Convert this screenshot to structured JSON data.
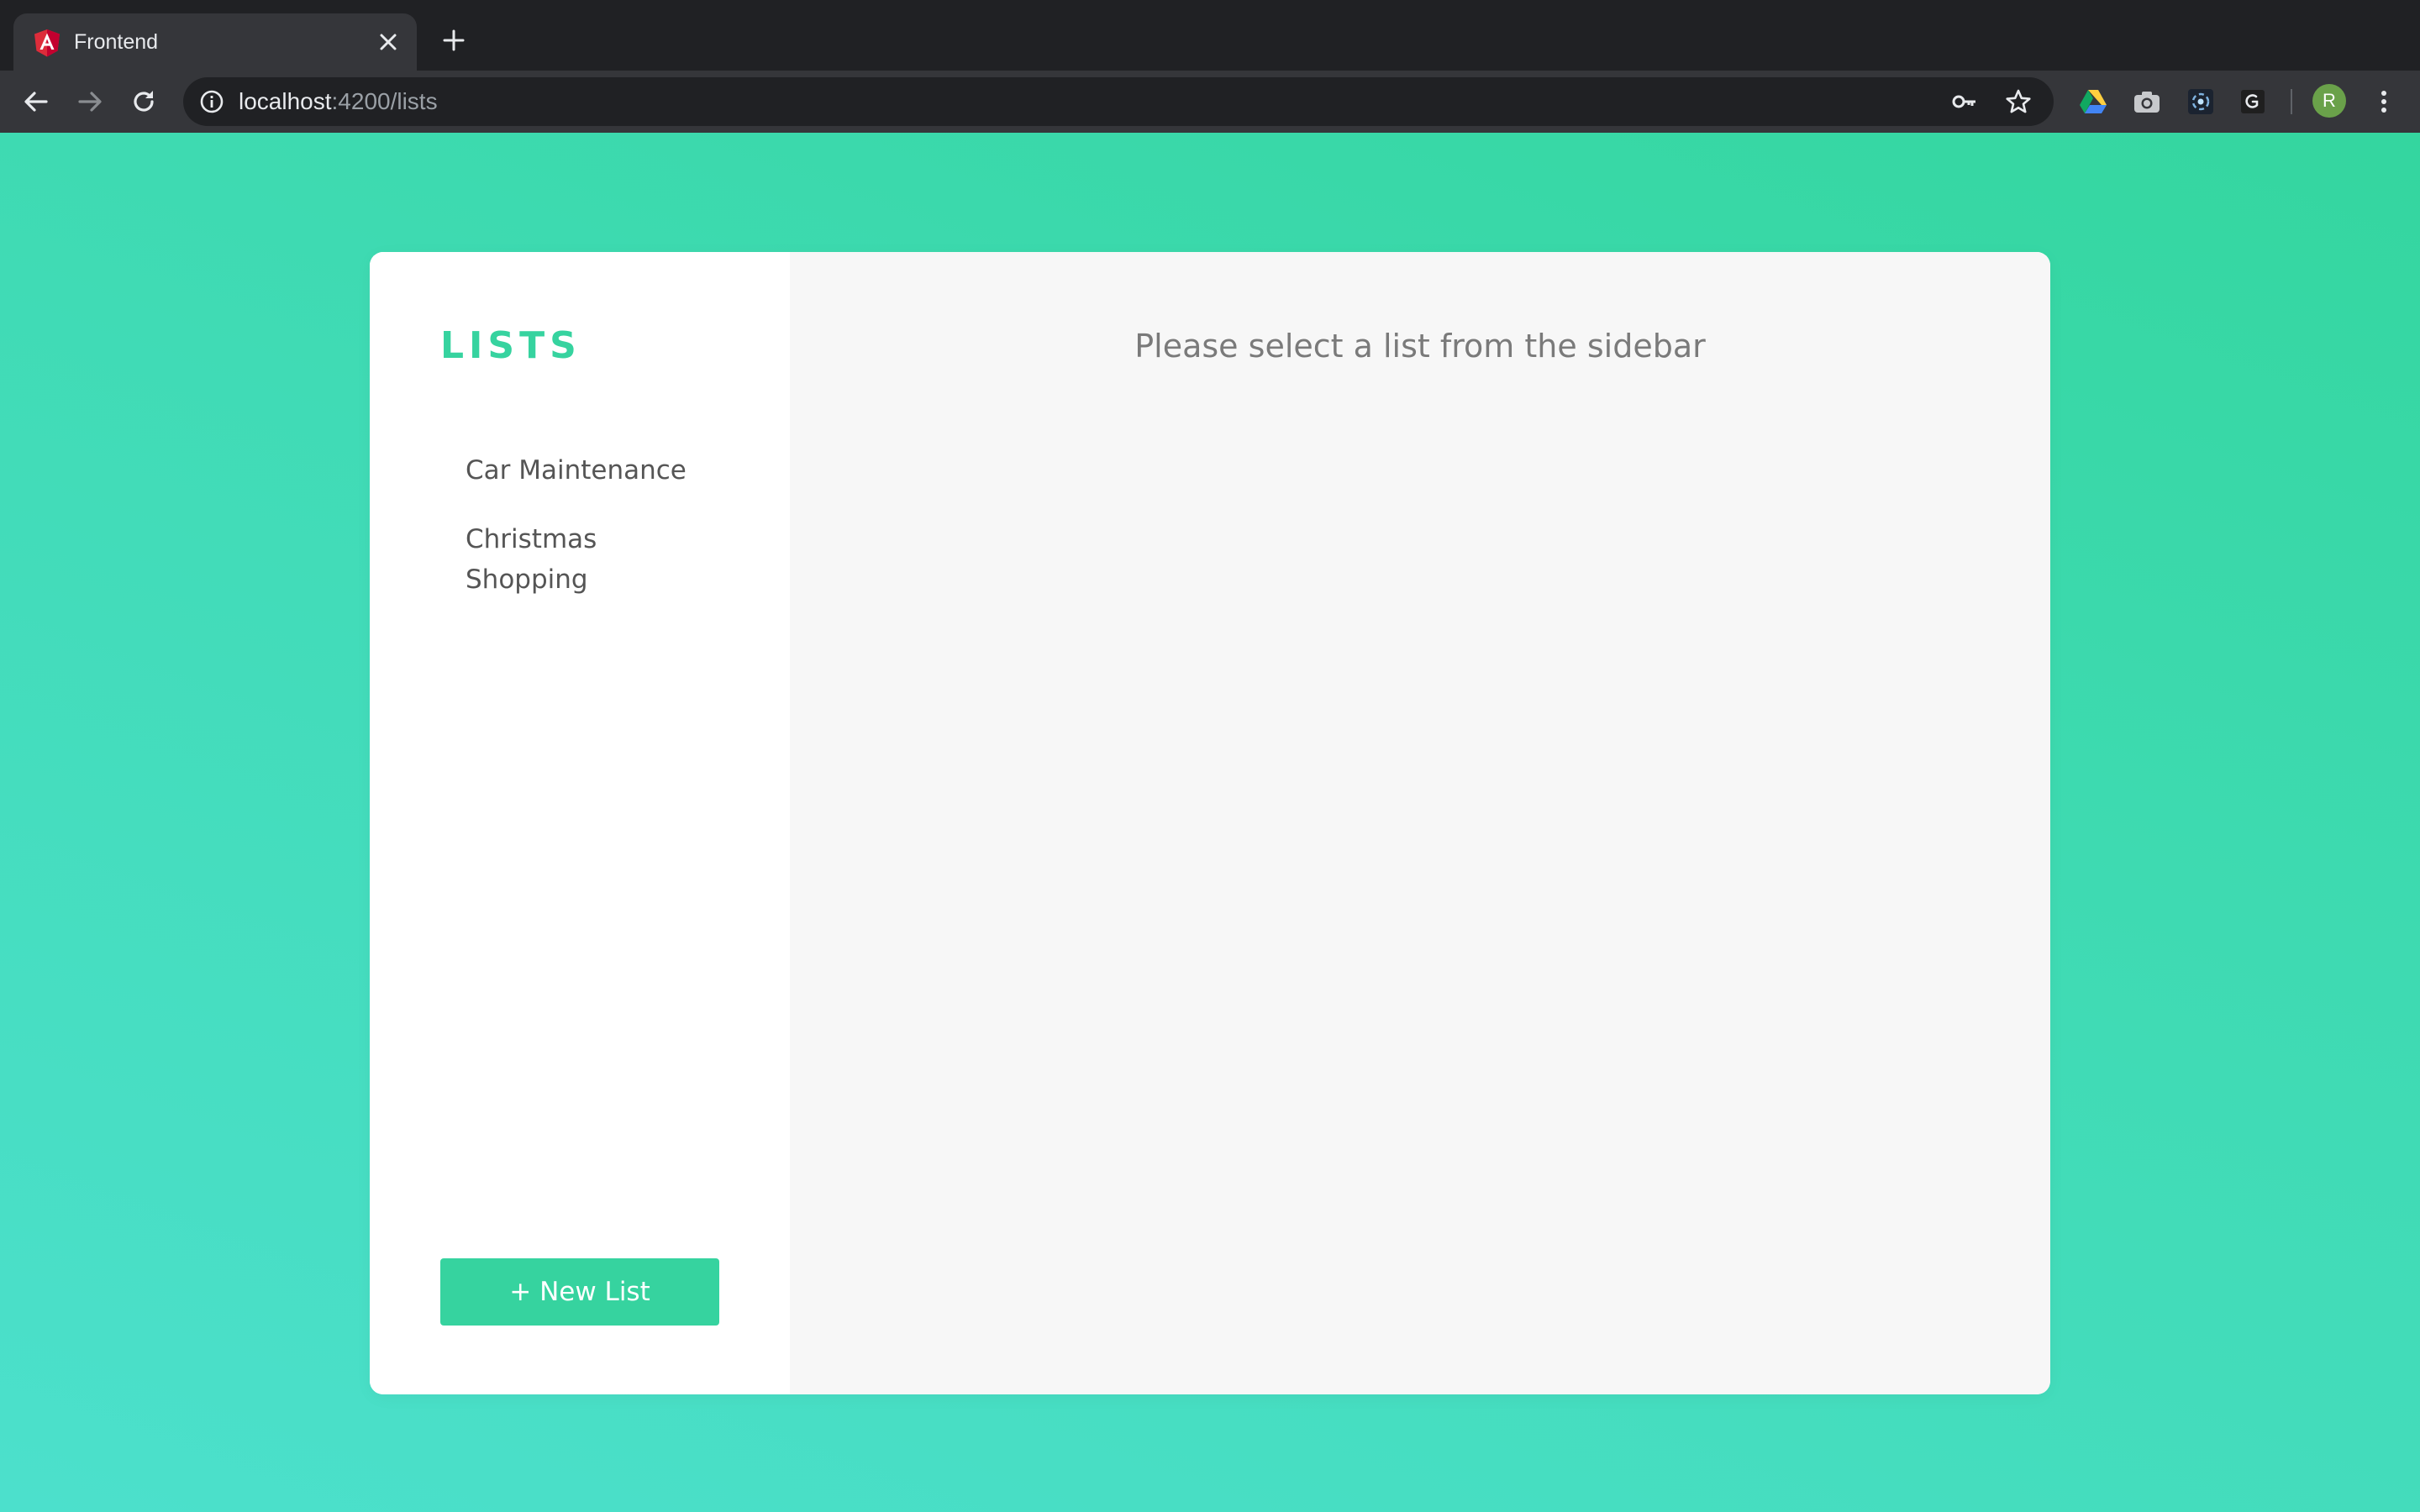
{
  "browser": {
    "tab": {
      "title": "Frontend",
      "favicon_icon": "angular-logo-icon"
    },
    "new_tab_icon": "plus-icon",
    "address_bar": {
      "host": "localhost",
      "path": ":4200/lists",
      "info_icon": "info-icon"
    },
    "omnibox_icons": [
      "key-icon",
      "star-icon"
    ],
    "extensions": [
      "google-drive-icon",
      "camera-icon",
      "extension-galaxy-icon",
      "extension-g-icon"
    ],
    "profile_initial": "R",
    "menu_icon": "more-vertical-icon"
  },
  "app": {
    "sidebar": {
      "title": "LISTS",
      "items": [
        {
          "label": "Car Maintenance"
        },
        {
          "label": "Christmas Shopping"
        }
      ],
      "new_list_label": "+ New List"
    },
    "main": {
      "empty_message": "Please select a list from the sidebar"
    }
  },
  "colors": {
    "accent": "#36d39f",
    "background_gradient_top": "#34d69f",
    "background_gradient_bottom": "#4ce0cc",
    "card_bg": "#ffffff",
    "main_panel_bg": "#f7f7f7",
    "browser_dark": "#202124",
    "browser_toolbar": "#35363a"
  }
}
